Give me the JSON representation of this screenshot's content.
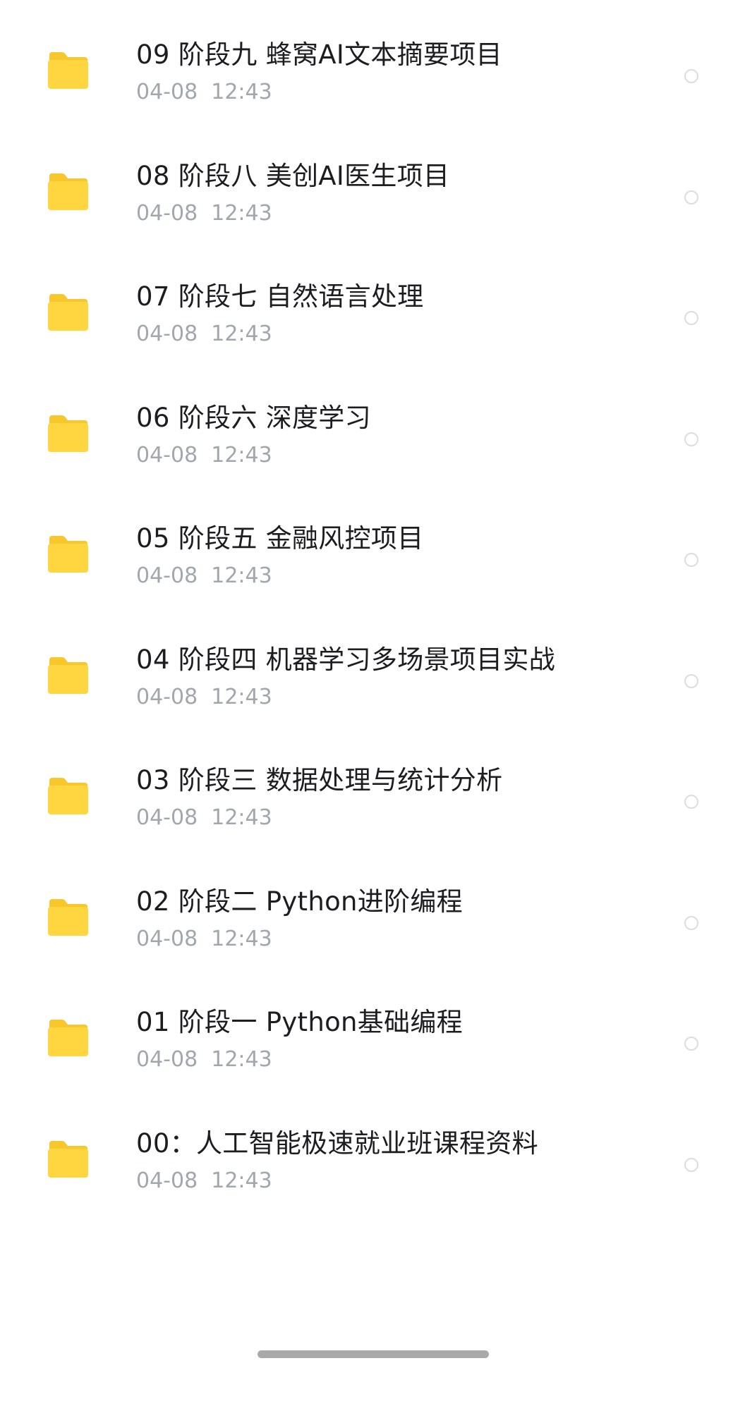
{
  "colors": {
    "folder": "#ffd63f",
    "folder_tab": "#f8c72c",
    "title_text": "#1d1d1f",
    "meta_text": "#a2a6ad",
    "radio_border": "#dcdde0",
    "home_indicator": "#a9a9ab"
  },
  "icons": {
    "item": "folder-icon",
    "selector": "radio-circle"
  },
  "files": [
    {
      "title": "09 阶段九 蜂窝AI文本摘要项目",
      "modified": "04-08  12:43"
    },
    {
      "title": "08 阶段八 美创AI医生项目",
      "modified": "04-08  12:43"
    },
    {
      "title": "07 阶段七 自然语言处理",
      "modified": "04-08  12:43"
    },
    {
      "title": "06 阶段六 深度学习",
      "modified": "04-08  12:43"
    },
    {
      "title": "05 阶段五 金融风控项目",
      "modified": "04-08  12:43"
    },
    {
      "title": "04 阶段四 机器学习多场景项目实战",
      "modified": "04-08  12:43"
    },
    {
      "title": "03 阶段三 数据处理与统计分析",
      "modified": "04-08  12:43"
    },
    {
      "title": "02 阶段二 Python进阶编程",
      "modified": "04-08  12:43"
    },
    {
      "title": "01 阶段一 Python基础编程",
      "modified": "04-08  12:43"
    },
    {
      "title": "00：人工智能极速就业班课程资料",
      "modified": "04-08  12:43"
    }
  ]
}
